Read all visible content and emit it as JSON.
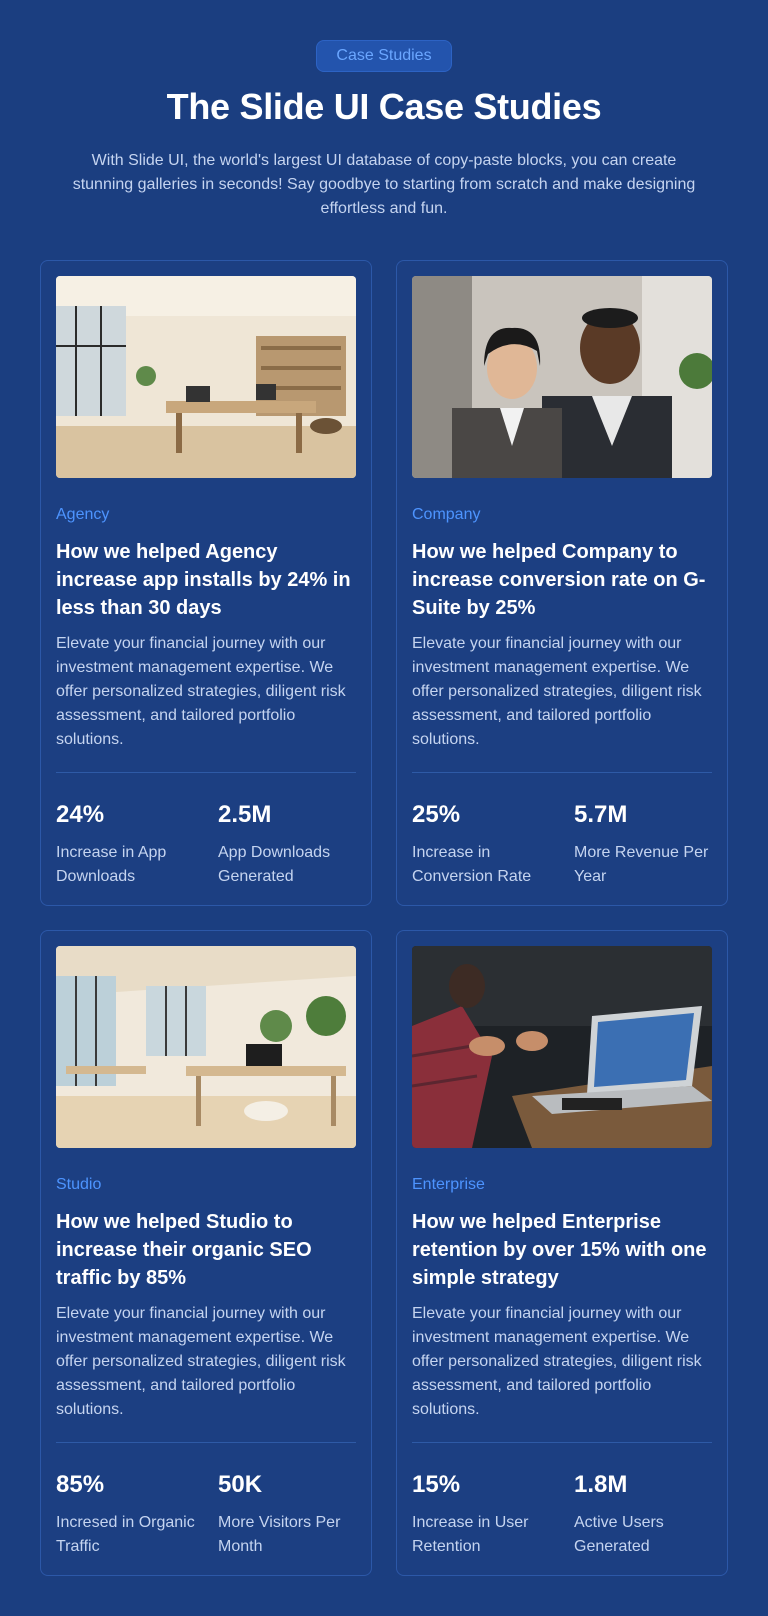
{
  "badge": "Case Studies",
  "title": "The Slide UI Case Studies",
  "subtitle": "With Slide UI, the world's largest UI database of copy-paste blocks, you can create stunning galleries in seconds! Say goodbye to starting from scratch and make designing effortless and fun.",
  "colors": {
    "background": "#1b3e80",
    "accent": "#4d94ff",
    "card_border": "#2c58a8"
  },
  "cards": [
    {
      "image": "office-interior-photo",
      "category": "Agency",
      "headline": "How we helped Agency increase app installs by 24% in less than 30 days",
      "description": "Elevate your financial journey with our investment management expertise. We offer personalized strategies, diligent risk assessment, and tailored portfolio solutions.",
      "stats": [
        {
          "value": "24%",
          "label": "Increase in App Downloads"
        },
        {
          "value": "2.5M",
          "label": "App Downloads Generated"
        }
      ]
    },
    {
      "image": "business-people-photo",
      "category": "Company",
      "headline": "How we helped Company to increase conversion rate on G-Suite by 25%",
      "description": "Elevate your financial journey with our investment management expertise. We offer personalized strategies, diligent risk assessment, and tailored portfolio solutions.",
      "stats": [
        {
          "value": "25%",
          "label": "Increase in Conversion Rate"
        },
        {
          "value": "5.7M",
          "label": "More Revenue Per Year"
        }
      ]
    },
    {
      "image": "open-office-photo",
      "category": "Studio",
      "headline": "How we helped Studio to increase their organic SEO traffic by 85%",
      "description": "Elevate your financial journey with our investment management expertise. We offer personalized strategies, diligent risk assessment, and tailored portfolio solutions.",
      "stats": [
        {
          "value": "85%",
          "label": "Incresed in Organic Traffic"
        },
        {
          "value": "50K",
          "label": "More Visitors Per Month"
        }
      ]
    },
    {
      "image": "meeting-laptop-photo",
      "category": "Enterprise",
      "headline": "How we helped Enterprise retention by over 15% with one simple strategy",
      "description": "Elevate your financial journey with our investment management expertise. We offer personalized strategies, diligent risk assessment, and tailored portfolio solutions.",
      "stats": [
        {
          "value": "15%",
          "label": "Increase in User Retention"
        },
        {
          "value": "1.8M",
          "label": "Active Users Generated"
        }
      ]
    }
  ]
}
